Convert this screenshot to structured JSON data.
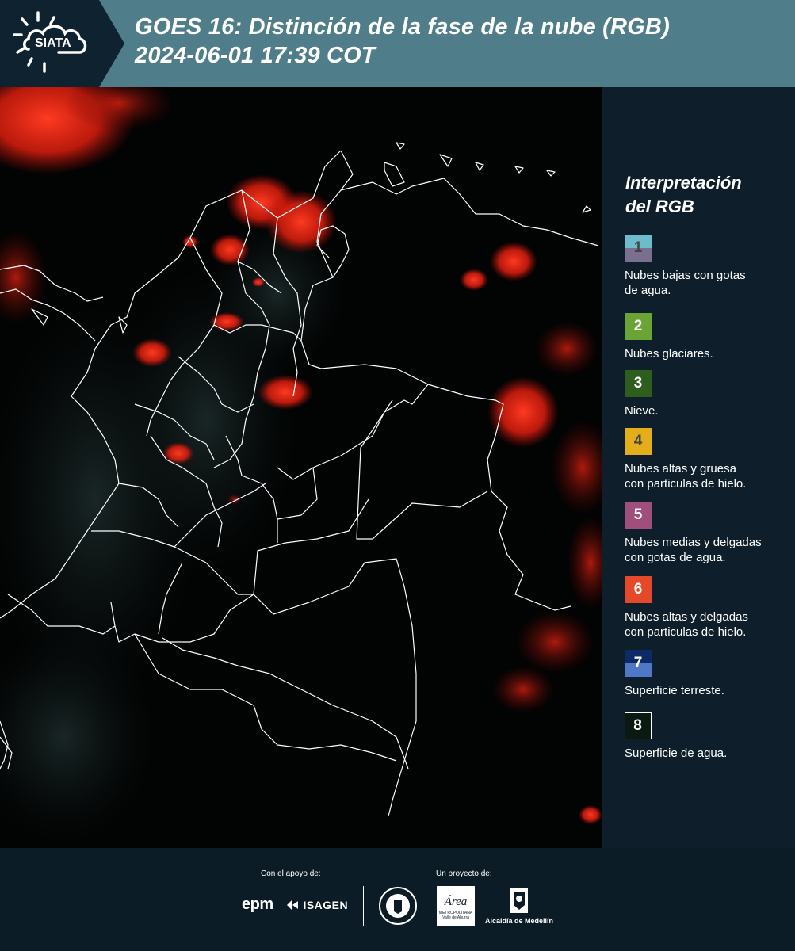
{
  "header": {
    "brand": "SIATA",
    "title_line1": "GOES 16: Distinción de la fase de la nube (RGB)",
    "title_line2": " 2024-06-01 17:39 COT"
  },
  "legend": {
    "title_line1": "Interpretación",
    "title_line2": "del RGB",
    "items": [
      {
        "num": "1",
        "label_line1": "Nubes bajas con gotas",
        "label_line2": "de agua.",
        "color_top": "#6cbccc",
        "color_bottom": "#7a6f8f",
        "num_color": "#444444"
      },
      {
        "num": "2",
        "label_line1": "Nubes glaciares.",
        "label_line2": "",
        "color_top": "#6aa434",
        "color_bottom": "#6aa434",
        "num_color": "#ffffff"
      },
      {
        "num": "3",
        "label_line1": "Nieve.",
        "label_line2": "",
        "color_top": "#2e5d1e",
        "color_bottom": "#2e5d1e",
        "num_color": "#ffffff"
      },
      {
        "num": "4",
        "label_line1": "Nubes altas y gruesa",
        "label_line2": "con particulas de hielo.",
        "color_top": "#e3ae1a",
        "color_bottom": "#e3ae1a",
        "num_color": "#444444"
      },
      {
        "num": "5",
        "label_line1": "Nubes medias y delgadas",
        "label_line2": "con gotas de agua.",
        "color_top": "#a04f7c",
        "color_bottom": "#a04f7c",
        "num_color": "#ffffff"
      },
      {
        "num": "6",
        "label_line1": "Nubes altas y delgadas",
        "label_line2": "con particulas de hielo.",
        "color_top": "#e6492a",
        "color_bottom": "#e6492a",
        "num_color": "#ffffff"
      },
      {
        "num": "7",
        "label_line1": "Superficie terreste.",
        "label_line2": "",
        "color_top": "#0e2a66",
        "color_bottom": "#4f78c6",
        "num_color": "#ffffff"
      },
      {
        "num": "8",
        "label_line1": "Superficie de agua.",
        "label_line2": "",
        "color_top": "#0a1a10",
        "color_bottom": "#0a1a10",
        "num_color": "#ffffff"
      }
    ]
  },
  "footer": {
    "support_label": "Con el apoyo de:",
    "project_label": "Un proyecto de:",
    "sponsor_epm": "epm",
    "sponsor_isagen": "ISAGEN",
    "partner_area": "Área",
    "partner_area_sub1": "METROPOLITANA",
    "partner_area_sub2": "Valle de Aburrá",
    "partner_alcaldia": "Alcaldía de Medellín"
  },
  "colors": {
    "cloud_red": "#ff2a1a",
    "border_white": "#ffffff",
    "header_bg": "#4f7d8a",
    "legend_bg": "#0e1f2b"
  }
}
